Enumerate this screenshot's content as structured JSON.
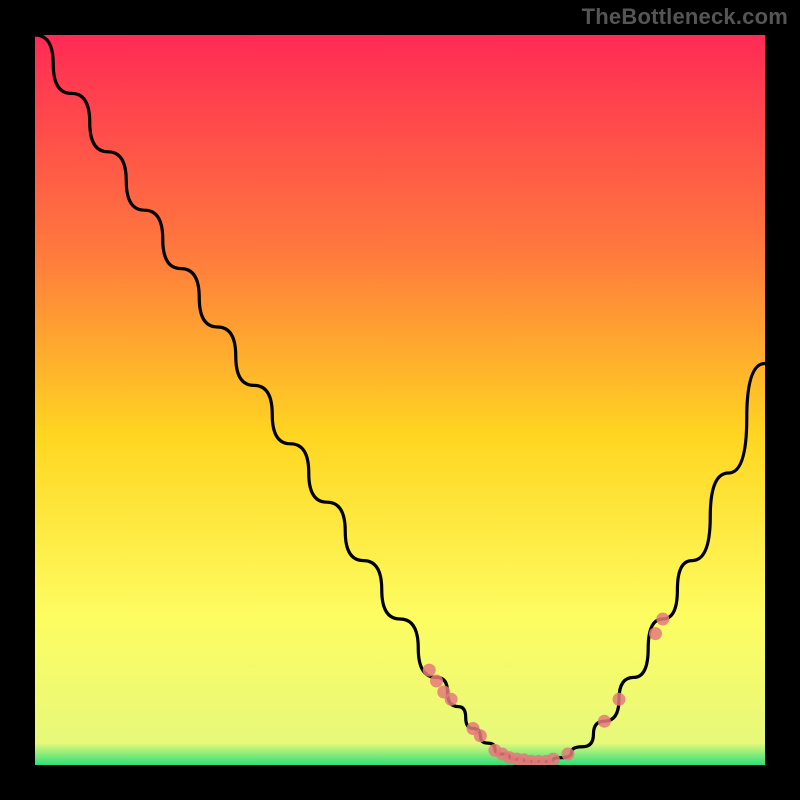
{
  "watermark": "TheBottleneck.com",
  "colors": {
    "background": "#000000",
    "curve": "#000000",
    "markers": "#e47a7a",
    "gradient_top": "#ff2a55",
    "gradient_mid_upper": "#ff7a3d",
    "gradient_mid": "#ffd621",
    "gradient_lower": "#fdfd62",
    "gradient_bottom": "#2de07a"
  },
  "chart_data": {
    "type": "line",
    "title": "",
    "xlabel": "",
    "ylabel": "",
    "xlim": [
      0,
      100
    ],
    "ylim": [
      0,
      100
    ],
    "grid": false,
    "series": [
      {
        "name": "bottleneck-curve",
        "x": [
          0,
          5,
          10,
          15,
          20,
          25,
          30,
          35,
          40,
          45,
          50,
          55,
          58,
          60,
          62,
          64,
          66,
          68,
          70,
          72,
          75,
          78,
          82,
          86,
          90,
          95,
          100
        ],
        "y": [
          100,
          92,
          84,
          76,
          68,
          60,
          52,
          44,
          36,
          28,
          20,
          12,
          8,
          5,
          3,
          1.5,
          0.8,
          0.5,
          0.5,
          1,
          2.5,
          6,
          12,
          20,
          28,
          40,
          55
        ]
      }
    ],
    "markers": {
      "name": "highlighted-points",
      "x": [
        54,
        55,
        56,
        57,
        60,
        61,
        63,
        64,
        65,
        66,
        67,
        68,
        69,
        70,
        71,
        73,
        78,
        80,
        85,
        86
      ],
      "y": [
        13,
        11.5,
        10,
        9,
        5,
        4,
        2,
        1.5,
        1,
        0.8,
        0.7,
        0.5,
        0.5,
        0.5,
        0.8,
        1.5,
        6,
        9,
        18,
        20
      ]
    }
  }
}
